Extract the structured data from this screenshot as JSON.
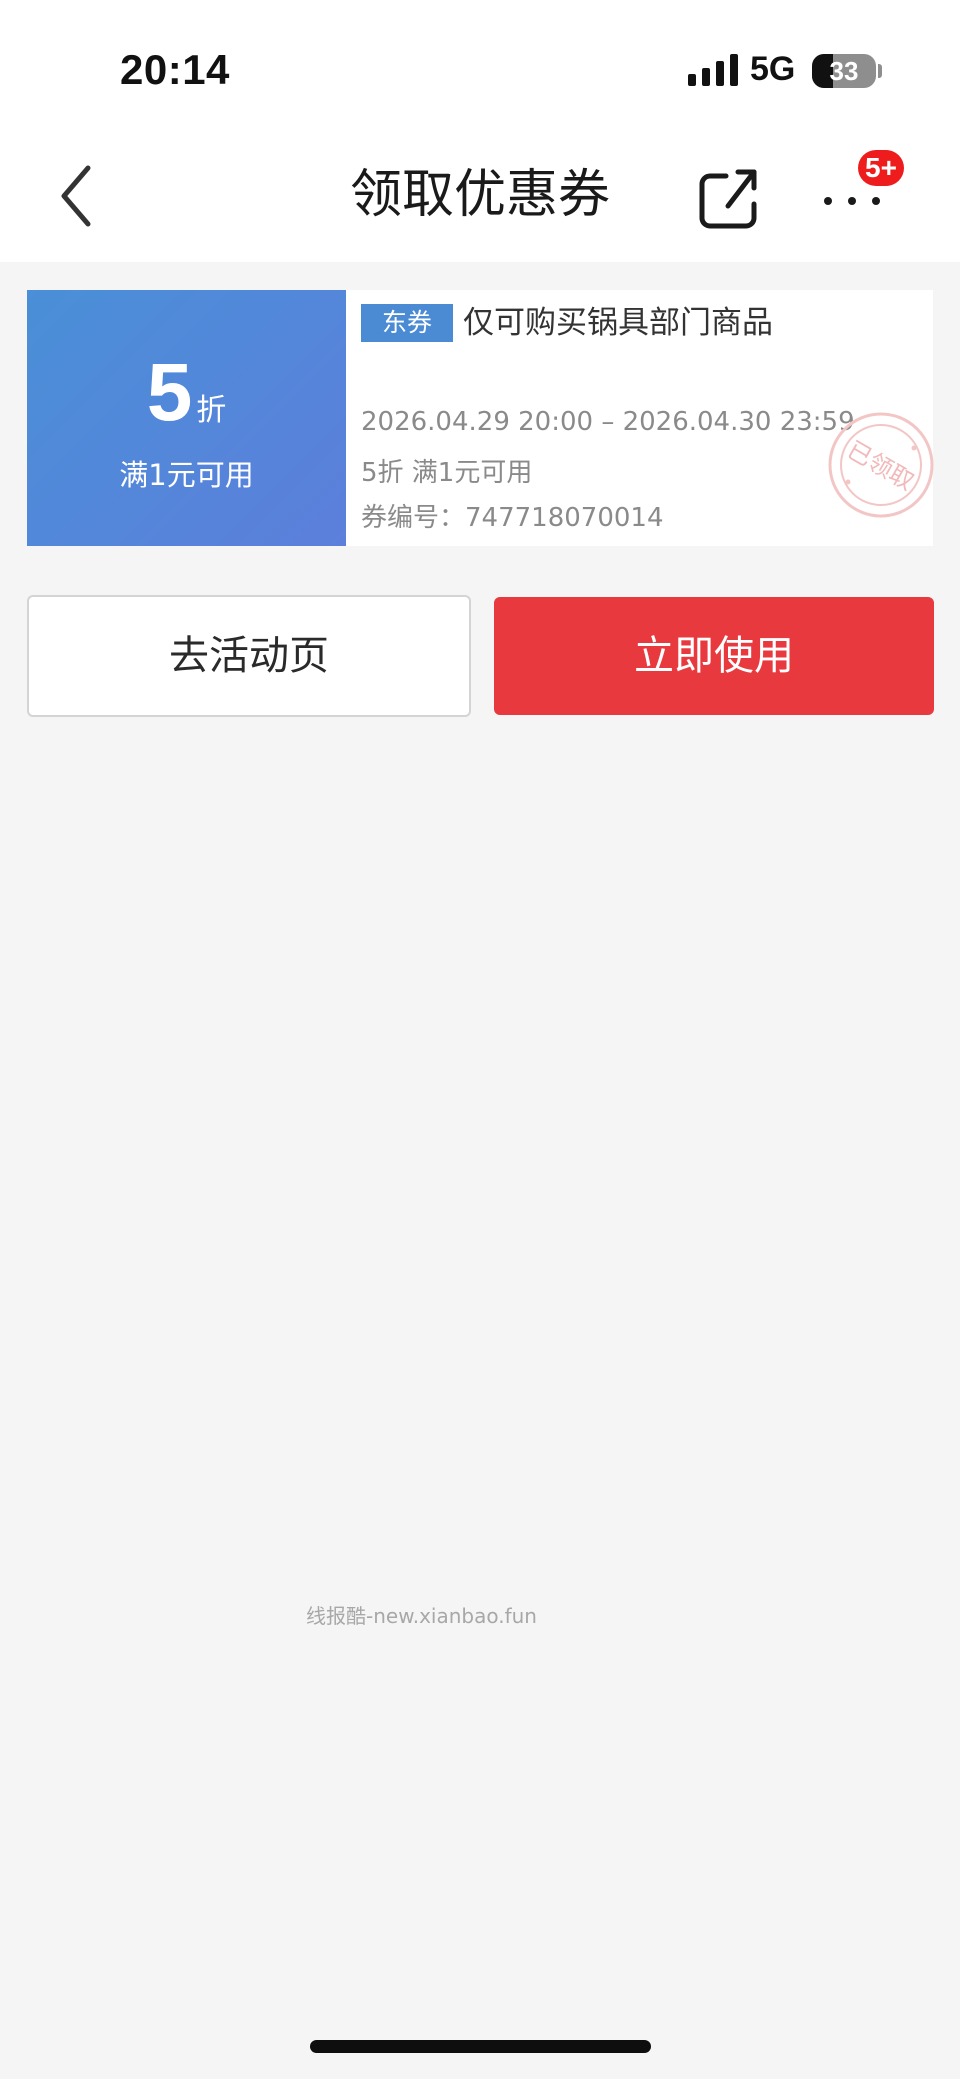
{
  "status_bar": {
    "time": "20:14",
    "network": "5G",
    "battery": "33",
    "battery_level_percent": 33
  },
  "nav": {
    "title": "领取优惠券",
    "more_badge": "5+"
  },
  "coupon": {
    "discount_value": "5",
    "discount_unit": "折",
    "condition": "满1元可用",
    "tag": "东券",
    "scope": "仅可购买锅具部门商品",
    "validity": "2026.04.29 20:00 – 2026.04.30 23:59",
    "rule": "5折 满1元可用",
    "number_label": "券编号：",
    "number": "747718070014",
    "stamp_text": "已领取",
    "accent_color": "#4a8bd4"
  },
  "actions": {
    "go_activity": "去活动页",
    "use_now": "立即使用",
    "use_now_color": "#e8393f"
  },
  "watermark": "线报酷-new.xianbao.fun"
}
